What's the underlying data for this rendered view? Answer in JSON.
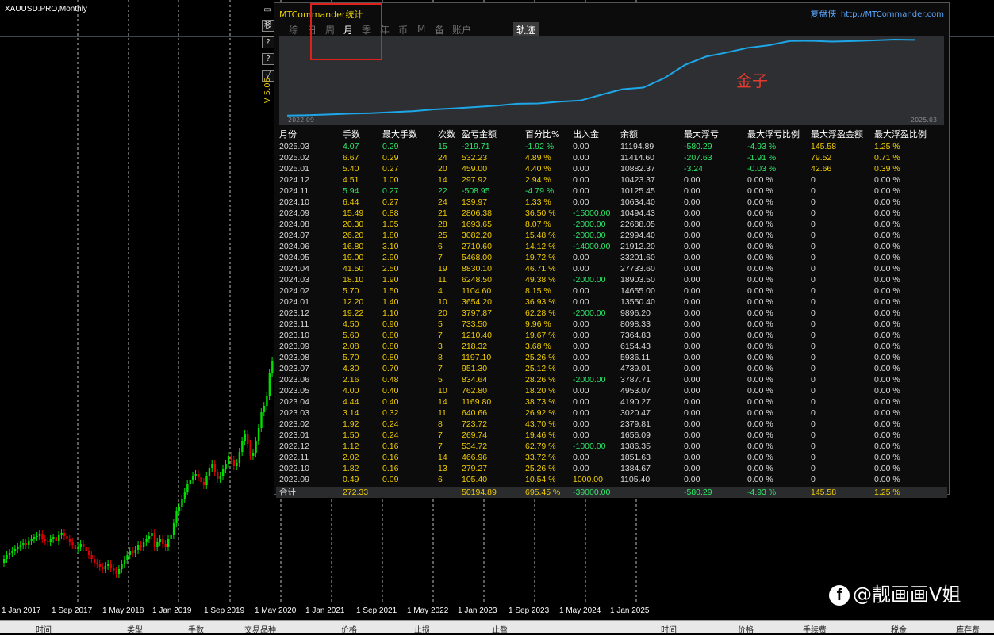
{
  "chart": {
    "symbol_label": "XAUUSD.PRO,Monthly",
    "dates": [
      "1 Jan 2017",
      "1 Sep 2017",
      "1 May 2018",
      "1 Jan 2019",
      "1 Sep 2019",
      "1 May 2020",
      "1 Jan 2021",
      "1 Sep 2021",
      "1 May 2022",
      "1 Jan 2023",
      "1 Sep 2023",
      "1 May 2024",
      "1 Jan 2025"
    ],
    "bull_color": "#00e000",
    "bear_color": "#e00000"
  },
  "side_buttons": [
    "移",
    "?",
    "?",
    "√"
  ],
  "version_label": "V 5.06",
  "panel": {
    "title": "MTCommander统计",
    "brand_cn": "复盘侠",
    "brand_url": "http://MTCommander.com",
    "tabs": [
      {
        "label": "综",
        "active": false
      },
      {
        "label": "日",
        "active": false
      },
      {
        "label": "周",
        "active": false
      },
      {
        "label": "月",
        "active": true
      },
      {
        "label": "季",
        "active": false
      },
      {
        "label": "年",
        "active": false
      },
      {
        "label": "币",
        "active": false
      },
      {
        "label": "M",
        "active": false
      },
      {
        "label": "备",
        "active": false
      },
      {
        "label": "账户",
        "active": false
      }
    ],
    "track_button": "轨迹",
    "equity": {
      "start_label": "2022.09",
      "end_label": "2025.03",
      "symbol_name": "金子",
      "line_color": "#1ea7e8"
    },
    "columns": [
      "月份",
      "手数",
      "最大手数",
      "次数",
      "盈亏金额",
      "百分比%",
      "出入金",
      "余额",
      "最大浮亏",
      "最大浮亏比例",
      "最大浮盈金额",
      "最大浮盈比例"
    ],
    "rows": [
      [
        "2025.03",
        "4.07",
        "0.29",
        "15",
        "-219.71",
        "-1.92 %",
        "0.00",
        "11194.89",
        "-580.29",
        "-4.93 %",
        "145.58",
        "1.25 %"
      ],
      [
        "2025.02",
        "6.67",
        "0.29",
        "24",
        "532.23",
        "4.89 %",
        "0.00",
        "11414.60",
        "-207.63",
        "-1.91 %",
        "79.52",
        "0.71 %"
      ],
      [
        "2025.01",
        "5.40",
        "0.27",
        "20",
        "459.00",
        "4.40 %",
        "0.00",
        "10882.37",
        "-3.24",
        "-0.03 %",
        "42.66",
        "0.39 %"
      ],
      [
        "2024.12",
        "4.51",
        "1.00",
        "14",
        "297.92",
        "2.94 %",
        "0.00",
        "10423.37",
        "0.00",
        "0.00 %",
        "0",
        "0.00 %"
      ],
      [
        "2024.11",
        "5.94",
        "0.27",
        "22",
        "-508.95",
        "-4.79 %",
        "0.00",
        "10125.45",
        "0.00",
        "0.00 %",
        "0",
        "0.00 %"
      ],
      [
        "2024.10",
        "6.44",
        "0.27",
        "24",
        "139.97",
        "1.33 %",
        "0.00",
        "10634.40",
        "0.00",
        "0.00 %",
        "0",
        "0.00 %"
      ],
      [
        "2024.09",
        "15.49",
        "0.88",
        "21",
        "2806.38",
        "36.50 %",
        "-15000.00",
        "10494.43",
        "0.00",
        "0.00 %",
        "0",
        "0.00 %"
      ],
      [
        "2024.08",
        "20.30",
        "1.05",
        "28",
        "1693.65",
        "8.07 %",
        "-2000.00",
        "22688.05",
        "0.00",
        "0.00 %",
        "0",
        "0.00 %"
      ],
      [
        "2024.07",
        "26.20",
        "1.80",
        "25",
        "3082.20",
        "15.48 %",
        "-2000.00",
        "22994.40",
        "0.00",
        "0.00 %",
        "0",
        "0.00 %"
      ],
      [
        "2024.06",
        "16.80",
        "3.10",
        "6",
        "2710.60",
        "14.12 %",
        "-14000.00",
        "21912.20",
        "0.00",
        "0.00 %",
        "0",
        "0.00 %"
      ],
      [
        "2024.05",
        "19.00",
        "2.90",
        "7",
        "5468.00",
        "19.72 %",
        "0.00",
        "33201.60",
        "0.00",
        "0.00 %",
        "0",
        "0.00 %"
      ],
      [
        "2024.04",
        "41.50",
        "2.50",
        "19",
        "8830.10",
        "46.71 %",
        "0.00",
        "27733.60",
        "0.00",
        "0.00 %",
        "0",
        "0.00 %"
      ],
      [
        "2024.03",
        "18.10",
        "1.90",
        "11",
        "6248.50",
        "49.38 %",
        "-2000.00",
        "18903.50",
        "0.00",
        "0.00 %",
        "0",
        "0.00 %"
      ],
      [
        "2024.02",
        "5.70",
        "1.50",
        "4",
        "1104.60",
        "8.15 %",
        "0.00",
        "14655.00",
        "0.00",
        "0.00 %",
        "0",
        "0.00 %"
      ],
      [
        "2024.01",
        "12.20",
        "1.40",
        "10",
        "3654.20",
        "36.93 %",
        "0.00",
        "13550.40",
        "0.00",
        "0.00 %",
        "0",
        "0.00 %"
      ],
      [
        "2023.12",
        "19.22",
        "1.10",
        "20",
        "3797.87",
        "62.28 %",
        "-2000.00",
        "9896.20",
        "0.00",
        "0.00 %",
        "0",
        "0.00 %"
      ],
      [
        "2023.11",
        "4.50",
        "0.90",
        "5",
        "733.50",
        "9.96 %",
        "0.00",
        "8098.33",
        "0.00",
        "0.00 %",
        "0",
        "0.00 %"
      ],
      [
        "2023.10",
        "5.60",
        "0.80",
        "7",
        "1210.40",
        "19.67 %",
        "0.00",
        "7364.83",
        "0.00",
        "0.00 %",
        "0",
        "0.00 %"
      ],
      [
        "2023.09",
        "2.08",
        "0.80",
        "3",
        "218.32",
        "3.68 %",
        "0.00",
        "6154.43",
        "0.00",
        "0.00 %",
        "0",
        "0.00 %"
      ],
      [
        "2023.08",
        "5.70",
        "0.80",
        "8",
        "1197.10",
        "25.26 %",
        "0.00",
        "5936.11",
        "0.00",
        "0.00 %",
        "0",
        "0.00 %"
      ],
      [
        "2023.07",
        "4.30",
        "0.70",
        "7",
        "951.30",
        "25.12 %",
        "0.00",
        "4739.01",
        "0.00",
        "0.00 %",
        "0",
        "0.00 %"
      ],
      [
        "2023.06",
        "2.16",
        "0.48",
        "5",
        "834.64",
        "28.26 %",
        "-2000.00",
        "3787.71",
        "0.00",
        "0.00 %",
        "0",
        "0.00 %"
      ],
      [
        "2023.05",
        "4.00",
        "0.40",
        "10",
        "762.80",
        "18.20 %",
        "0.00",
        "4953.07",
        "0.00",
        "0.00 %",
        "0",
        "0.00 %"
      ],
      [
        "2023.04",
        "4.44",
        "0.40",
        "14",
        "1169.80",
        "38.73 %",
        "0.00",
        "4190.27",
        "0.00",
        "0.00 %",
        "0",
        "0.00 %"
      ],
      [
        "2023.03",
        "3.14",
        "0.32",
        "11",
        "640.66",
        "26.92 %",
        "0.00",
        "3020.47",
        "0.00",
        "0.00 %",
        "0",
        "0.00 %"
      ],
      [
        "2023.02",
        "1.92",
        "0.24",
        "8",
        "723.72",
        "43.70 %",
        "0.00",
        "2379.81",
        "0.00",
        "0.00 %",
        "0",
        "0.00 %"
      ],
      [
        "2023.01",
        "1.50",
        "0.24",
        "7",
        "269.74",
        "19.46 %",
        "0.00",
        "1656.09",
        "0.00",
        "0.00 %",
        "0",
        "0.00 %"
      ],
      [
        "2022.12",
        "1.12",
        "0.16",
        "7",
        "534.72",
        "62.79 %",
        "-1000.00",
        "1386.35",
        "0.00",
        "0.00 %",
        "0",
        "0.00 %"
      ],
      [
        "2022.11",
        "2.02",
        "0.16",
        "14",
        "466.96",
        "33.72 %",
        "0.00",
        "1851.63",
        "0.00",
        "0.00 %",
        "0",
        "0.00 %"
      ],
      [
        "2022.10",
        "1.82",
        "0.16",
        "13",
        "279.27",
        "25.26 %",
        "0.00",
        "1384.67",
        "0.00",
        "0.00 %",
        "0",
        "0.00 %"
      ],
      [
        "2022.09",
        "0.49",
        "0.09",
        "6",
        "105.40",
        "10.54 %",
        "1000.00",
        "1105.40",
        "0.00",
        "0.00 %",
        "0",
        "0.00 %"
      ]
    ],
    "total": [
      "合计",
      "272.33",
      "",
      "",
      "50194.89",
      "695.45 %",
      "-39000.00",
      "",
      "-580.29",
      "-4.93 %",
      "145.58",
      "1.25 %"
    ]
  },
  "watermark": "@靓画画V姐",
  "watermark_icon": "f",
  "bottom_headers": [
    "时间",
    "类型",
    "手数",
    "交易品种",
    "价格",
    "止损",
    "止盈",
    "时间",
    "价格",
    "手续费",
    "税金",
    "库存费"
  ]
}
